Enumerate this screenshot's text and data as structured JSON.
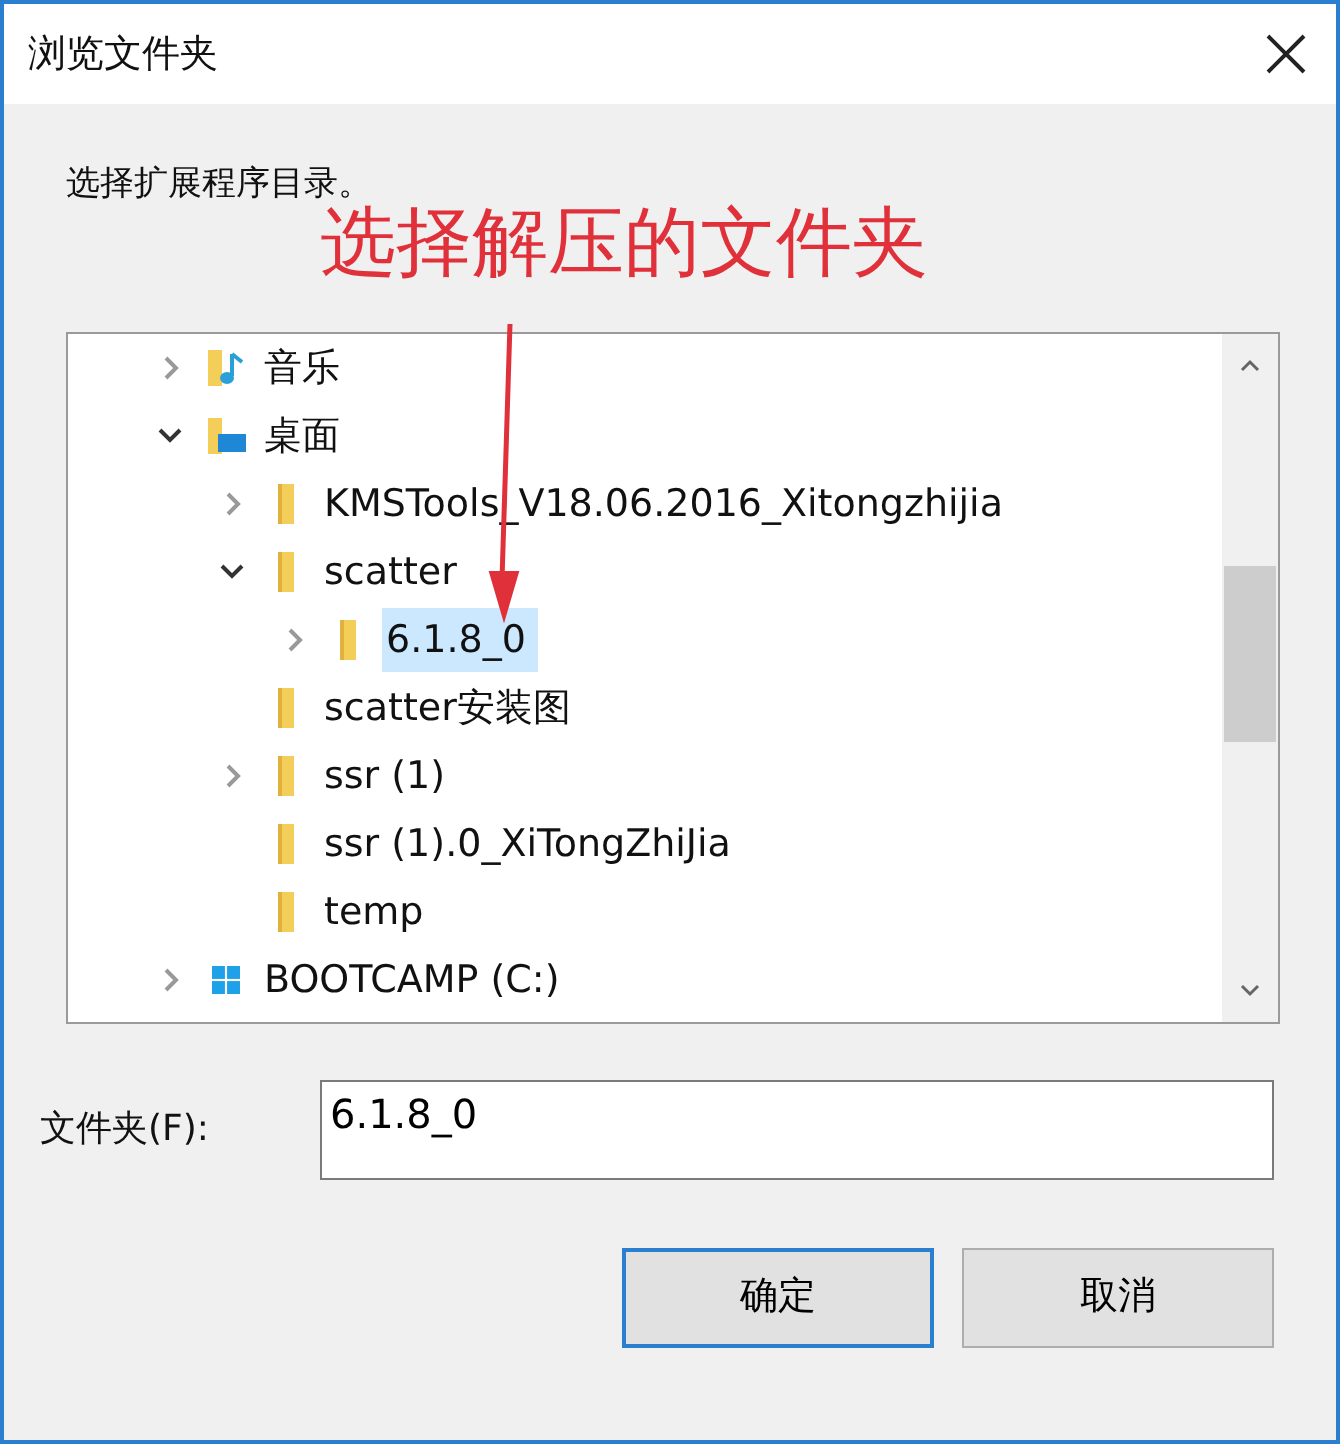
{
  "window": {
    "title": "浏览文件夹"
  },
  "instruction": "选择扩展程序目录。",
  "annotation": {
    "text": "选择解压的文件夹",
    "color": "#e0303a"
  },
  "tree": [
    {
      "label": "音乐",
      "kind": "music",
      "expanded": false,
      "selected": false
    },
    {
      "label": "桌面",
      "kind": "desktop",
      "expanded": true,
      "selected": false,
      "children": [
        {
          "label": "KMSTools_V18.06.2016_Xitongzhijia",
          "kind": "folder",
          "expanded": false,
          "selected": false
        },
        {
          "label": "scatter",
          "kind": "folder",
          "expanded": true,
          "selected": false,
          "children": [
            {
              "label": "6.1.8_0",
              "kind": "folder",
              "expanded": false,
              "selected": true
            }
          ]
        },
        {
          "label": "scatter安装图",
          "kind": "folder",
          "selected": false
        },
        {
          "label": "ssr (1)",
          "kind": "folder",
          "expanded": false,
          "selected": false
        },
        {
          "label": "ssr (1).0_XiTongZhiJia",
          "kind": "folder",
          "selected": false
        },
        {
          "label": "temp",
          "kind": "folder",
          "selected": false
        }
      ]
    },
    {
      "label": "BOOTCAMP (C:)",
      "kind": "drive",
      "expanded": false,
      "selected": false
    }
  ],
  "folder_field": {
    "label": "文件夹(F):",
    "value": "6.1.8_0"
  },
  "buttons": [
    {
      "label": "确定",
      "default": true
    },
    {
      "label": "取消",
      "default": false
    }
  ]
}
